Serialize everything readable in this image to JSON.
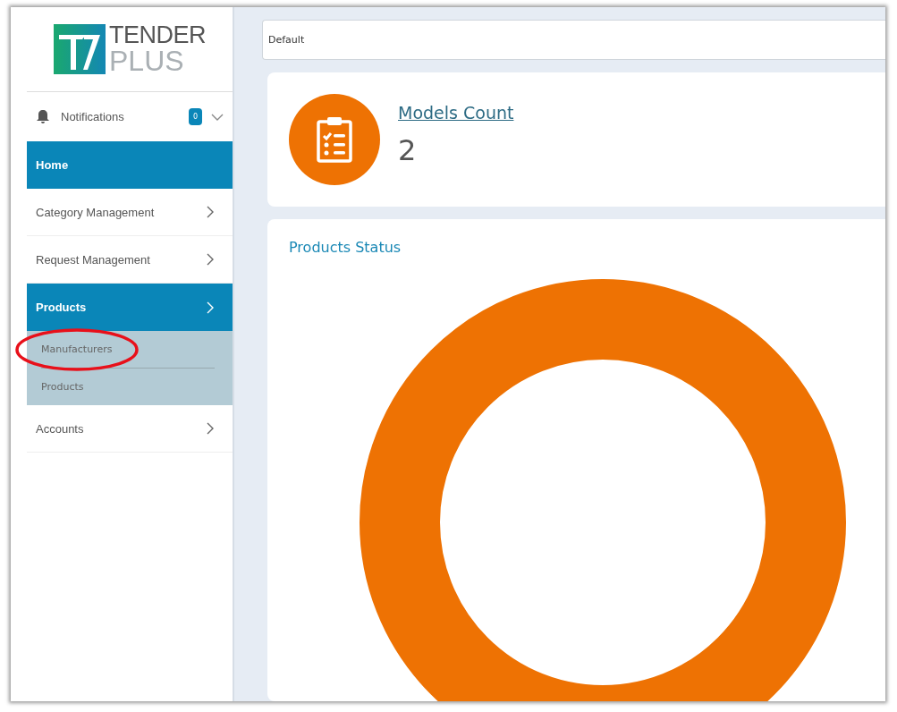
{
  "logo": {
    "line_1": "TENDER",
    "line_2": "PLUS"
  },
  "notifications": {
    "label": "Notifications",
    "count": "0"
  },
  "nav": [
    {
      "label": "Home",
      "selected": true,
      "has_submenu": false
    },
    {
      "label": "Category Management",
      "selected": false,
      "has_submenu": true
    },
    {
      "label": "Request Management",
      "selected": false,
      "has_submenu": true
    },
    {
      "label": "Products",
      "selected": true,
      "has_submenu": true,
      "children": [
        {
          "label": "Manufacturers",
          "circled": true
        },
        {
          "label": "Products",
          "circled": false
        }
      ]
    },
    {
      "label": "Accounts",
      "selected": false,
      "has_submenu": true
    }
  ],
  "filter": {
    "value": "Default"
  },
  "stat_card": {
    "title": "Models Count",
    "value": "2"
  },
  "chart_card": {
    "title": "Products Status"
  }
}
